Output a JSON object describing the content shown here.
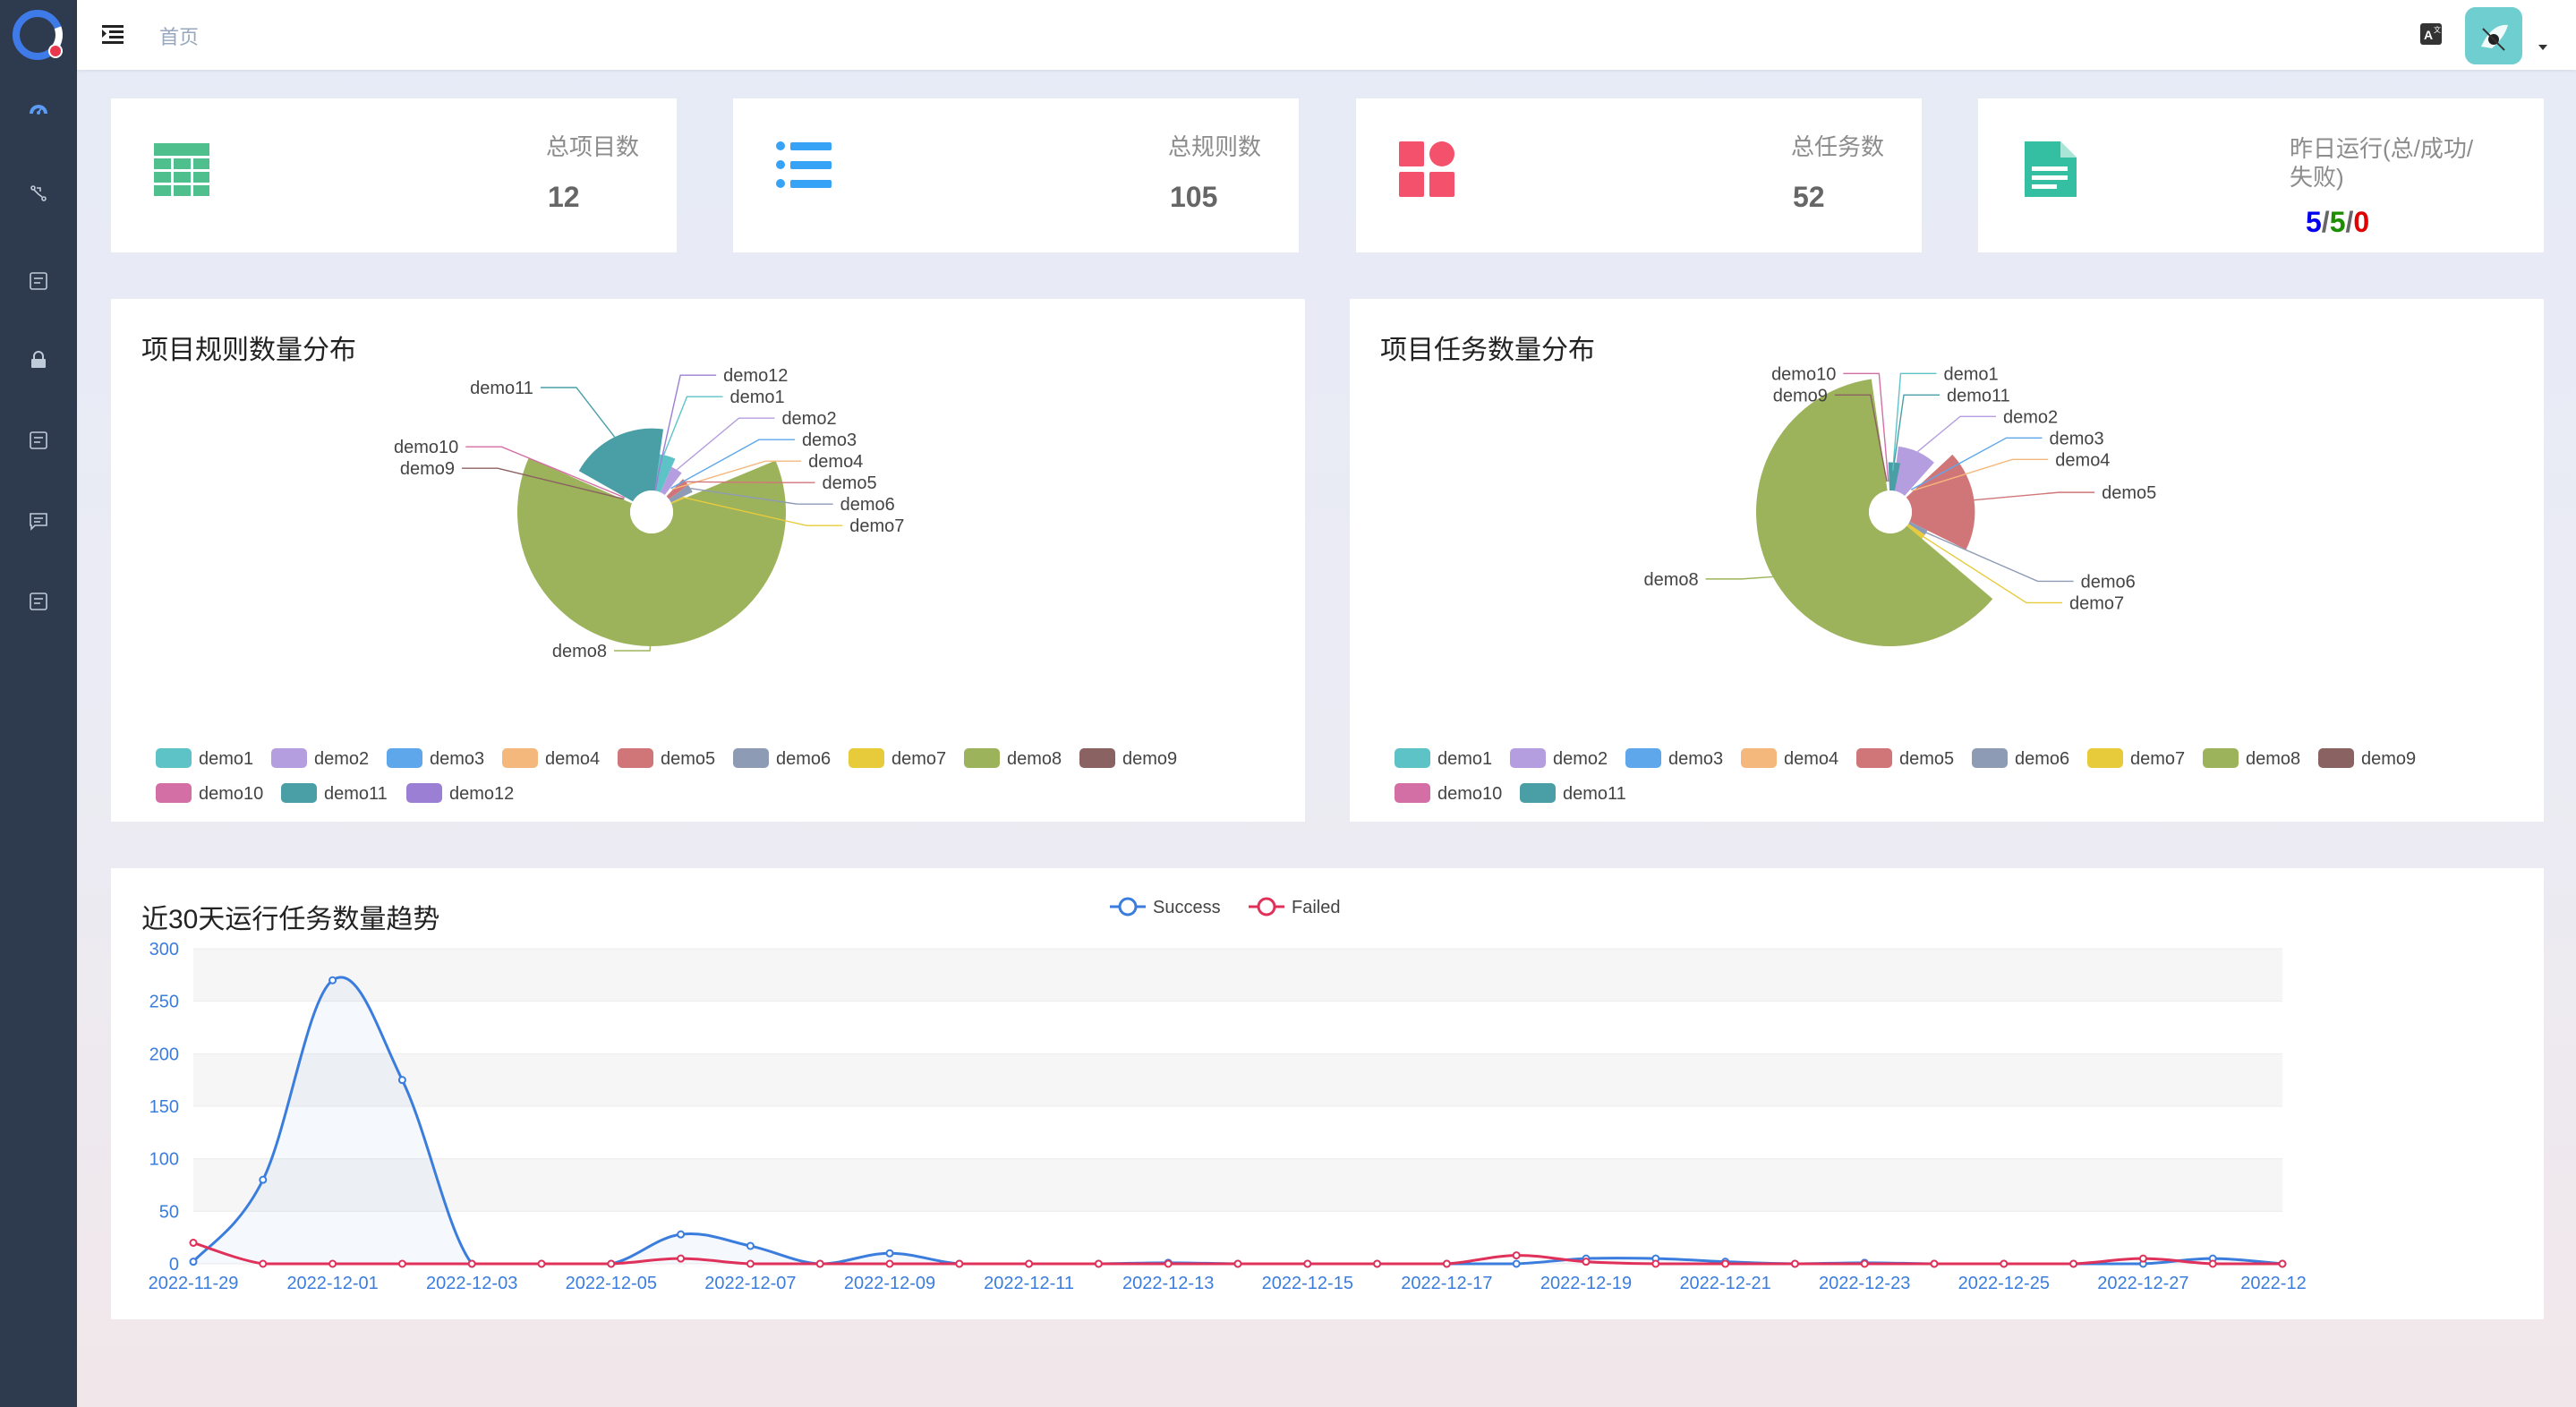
{
  "header": {
    "breadcrumb": "首页"
  },
  "sidebar": {
    "items": [
      {
        "icon": "dashboard-icon"
      },
      {
        "icon": "route-icon"
      },
      {
        "icon": "form-icon"
      },
      {
        "icon": "lock-icon"
      },
      {
        "icon": "form-icon"
      },
      {
        "icon": "message-icon"
      },
      {
        "icon": "form-icon"
      }
    ]
  },
  "stats": [
    {
      "title": "总项目数",
      "value": "12",
      "icon": "table-icon",
      "color": "#4fc08d"
    },
    {
      "title": "总规则数",
      "value": "105",
      "icon": "list-icon",
      "color": "#36a3f7"
    },
    {
      "title": "总任务数",
      "value": "52",
      "icon": "shapes-icon",
      "color": "#f4516c"
    },
    {
      "title_line1": "昨日运行(总/成功/",
      "title_line2": "失败)",
      "icon": "document-icon",
      "color": "#34bfa3",
      "total": "5",
      "success": "5",
      "failed": "0",
      "sep": "/",
      "total_color": "#0000ee",
      "success_color": "#1e8e00",
      "failed_color": "#e00000"
    }
  ],
  "pie_rules": {
    "title": "项目规则数量分布"
  },
  "pie_tasks": {
    "title": "项目任务数量分布"
  },
  "trend": {
    "title": "近30天运行任务数量趋势"
  },
  "chart_data": [
    {
      "type": "pie",
      "subtype": "rose",
      "title": "项目规则数量分布",
      "categories": [
        "demo1",
        "demo2",
        "demo3",
        "demo4",
        "demo5",
        "demo6",
        "demo7",
        "demo8",
        "demo9",
        "demo10",
        "demo11",
        "demo12"
      ],
      "values": [
        7,
        4,
        0,
        0,
        3,
        3,
        1,
        66,
        0,
        0,
        20,
        1
      ],
      "colors": [
        "#5ec3c7",
        "#b59ee0",
        "#5ea7ea",
        "#f5b87c",
        "#d17678",
        "#8e9bb5",
        "#e8cb3b",
        "#9db35b",
        "#8b6262",
        "#d46fa5",
        "#4a9ea6",
        "#9b7fd4"
      ],
      "legend": "bottom"
    },
    {
      "type": "pie",
      "subtype": "rose",
      "title": "项目任务数量分布",
      "categories": [
        "demo1",
        "demo2",
        "demo3",
        "demo4",
        "demo5",
        "demo6",
        "demo7",
        "demo8",
        "demo9",
        "demo10",
        "demo11"
      ],
      "values": [
        1,
        5,
        0,
        0,
        10,
        1,
        1,
        32,
        0,
        0,
        2
      ],
      "colors": [
        "#5ec3c7",
        "#b59ee0",
        "#5ea7ea",
        "#f5b87c",
        "#d17678",
        "#8e9bb5",
        "#e8cb3b",
        "#9db35b",
        "#8b6262",
        "#d46fa5",
        "#4a9ea6"
      ],
      "legend": "bottom"
    },
    {
      "type": "line",
      "title": "近30天运行任务数量趋势",
      "x": [
        "2022-11-29",
        "2022-11-30",
        "2022-12-01",
        "2022-12-02",
        "2022-12-03",
        "2022-12-04",
        "2022-12-05",
        "2022-12-06",
        "2022-12-07",
        "2022-12-08",
        "2022-12-09",
        "2022-12-10",
        "2022-12-11",
        "2022-12-12",
        "2022-12-13",
        "2022-12-14",
        "2022-12-15",
        "2022-12-16",
        "2022-12-17",
        "2022-12-18",
        "2022-12-19",
        "2022-12-20",
        "2022-12-21",
        "2022-12-22",
        "2022-12-23",
        "2022-12-24",
        "2022-12-25",
        "2022-12-26",
        "2022-12-27",
        "2022-12-28",
        "2022-12-29"
      ],
      "xticks": [
        "2022-11-29",
        "2022-12-01",
        "2022-12-03",
        "2022-12-05",
        "2022-12-07",
        "2022-12-09",
        "2022-12-11",
        "2022-12-13",
        "2022-12-15",
        "2022-12-17",
        "2022-12-19",
        "2022-12-21",
        "2022-12-23",
        "2022-12-25",
        "2022-12-27",
        "2022-12"
      ],
      "series": [
        {
          "name": "Success",
          "color": "#3b7ddd",
          "values": [
            2,
            80,
            270,
            175,
            0,
            0,
            0,
            28,
            17,
            0,
            10,
            0,
            0,
            0,
            1,
            0,
            0,
            0,
            0,
            0,
            5,
            5,
            2,
            0,
            1,
            0,
            0,
            0,
            0,
            5,
            0
          ]
        },
        {
          "name": "Failed",
          "color": "#e0315a",
          "values": [
            20,
            0,
            0,
            0,
            0,
            0,
            0,
            5,
            0,
            0,
            0,
            0,
            0,
            0,
            0,
            0,
            0,
            0,
            0,
            8,
            2,
            0,
            0,
            0,
            0,
            0,
            0,
            0,
            5,
            0,
            0
          ]
        }
      ],
      "ylim": [
        0,
        300
      ],
      "yticks": [
        0,
        50,
        100,
        150,
        200,
        250,
        300
      ],
      "legend": "top"
    }
  ]
}
